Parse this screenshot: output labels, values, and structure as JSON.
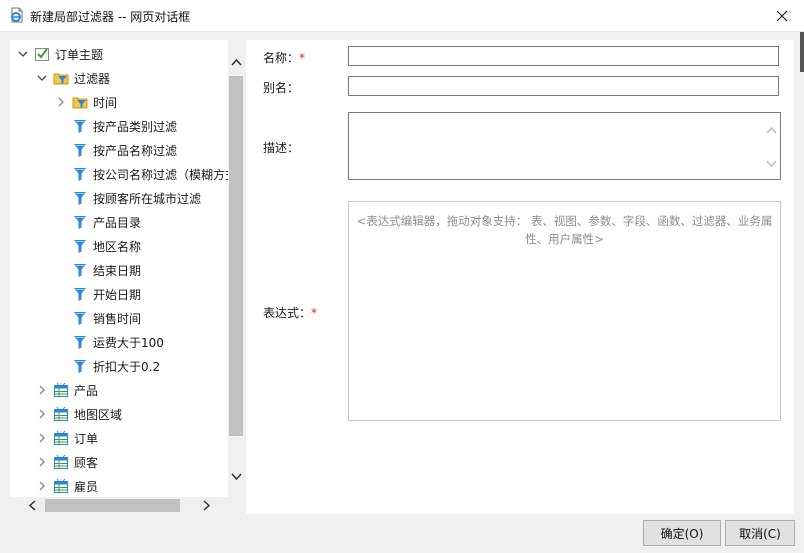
{
  "window": {
    "title": "新建局部过滤器 -- 网页对话框",
    "icon": "ie-document-icon",
    "close_icon": "close-icon"
  },
  "tree": {
    "nodes": [
      {
        "label": "订单主题",
        "icon": "subject-checked-icon",
        "expander": "expanded"
      },
      {
        "label": "过滤器",
        "icon": "filter-folder-icon",
        "expander": "expanded"
      },
      {
        "label": "时间",
        "icon": "filter-folder-icon",
        "expander": "collapsed"
      },
      {
        "label": "按产品类别过滤",
        "icon": "filter-icon",
        "expander": "none"
      },
      {
        "label": "按产品名称过滤",
        "icon": "filter-icon",
        "expander": "none"
      },
      {
        "label": "按公司名称过滤（模糊方式",
        "icon": "filter-icon",
        "expander": "none"
      },
      {
        "label": "按顾客所在城市过滤",
        "icon": "filter-icon",
        "expander": "none"
      },
      {
        "label": "产品目录",
        "icon": "filter-icon",
        "expander": "none"
      },
      {
        "label": "地区名称",
        "icon": "filter-icon",
        "expander": "none"
      },
      {
        "label": "结束日期",
        "icon": "filter-icon",
        "expander": "none"
      },
      {
        "label": "开始日期",
        "icon": "filter-icon",
        "expander": "none"
      },
      {
        "label": "销售时间",
        "icon": "filter-icon",
        "expander": "none"
      },
      {
        "label": "运费大于100",
        "icon": "filter-icon",
        "expander": "none"
      },
      {
        "label": "折扣大于0.2",
        "icon": "filter-icon",
        "expander": "none"
      },
      {
        "label": "产品",
        "icon": "table-icon",
        "expander": "collapsed"
      },
      {
        "label": "地图区域",
        "icon": "table-icon",
        "expander": "collapsed"
      },
      {
        "label": "订单",
        "icon": "table-icon",
        "expander": "collapsed"
      },
      {
        "label": "顾客",
        "icon": "table-icon",
        "expander": "collapsed"
      },
      {
        "label": "雇员",
        "icon": "table-icon",
        "expander": "collapsed"
      }
    ]
  },
  "form": {
    "name_label": "名称：",
    "alias_label": "别名：",
    "desc_label": "描述：",
    "expr_label": "表达式：",
    "required_mark": "*",
    "name_value": "",
    "alias_value": "",
    "expr_placeholder": "<表达式编辑器，拖动对象支持： 表、视图、参数、字段、函数、过滤器、业务属性、用户属性>"
  },
  "buttons": {
    "ok": "确定(O)",
    "cancel": "取消(C)"
  },
  "colors": {
    "filter_icon": "#2f86d6",
    "folder_icon": "#f3c64a",
    "check_icon": "#3aa13a",
    "required": "#e02020"
  }
}
